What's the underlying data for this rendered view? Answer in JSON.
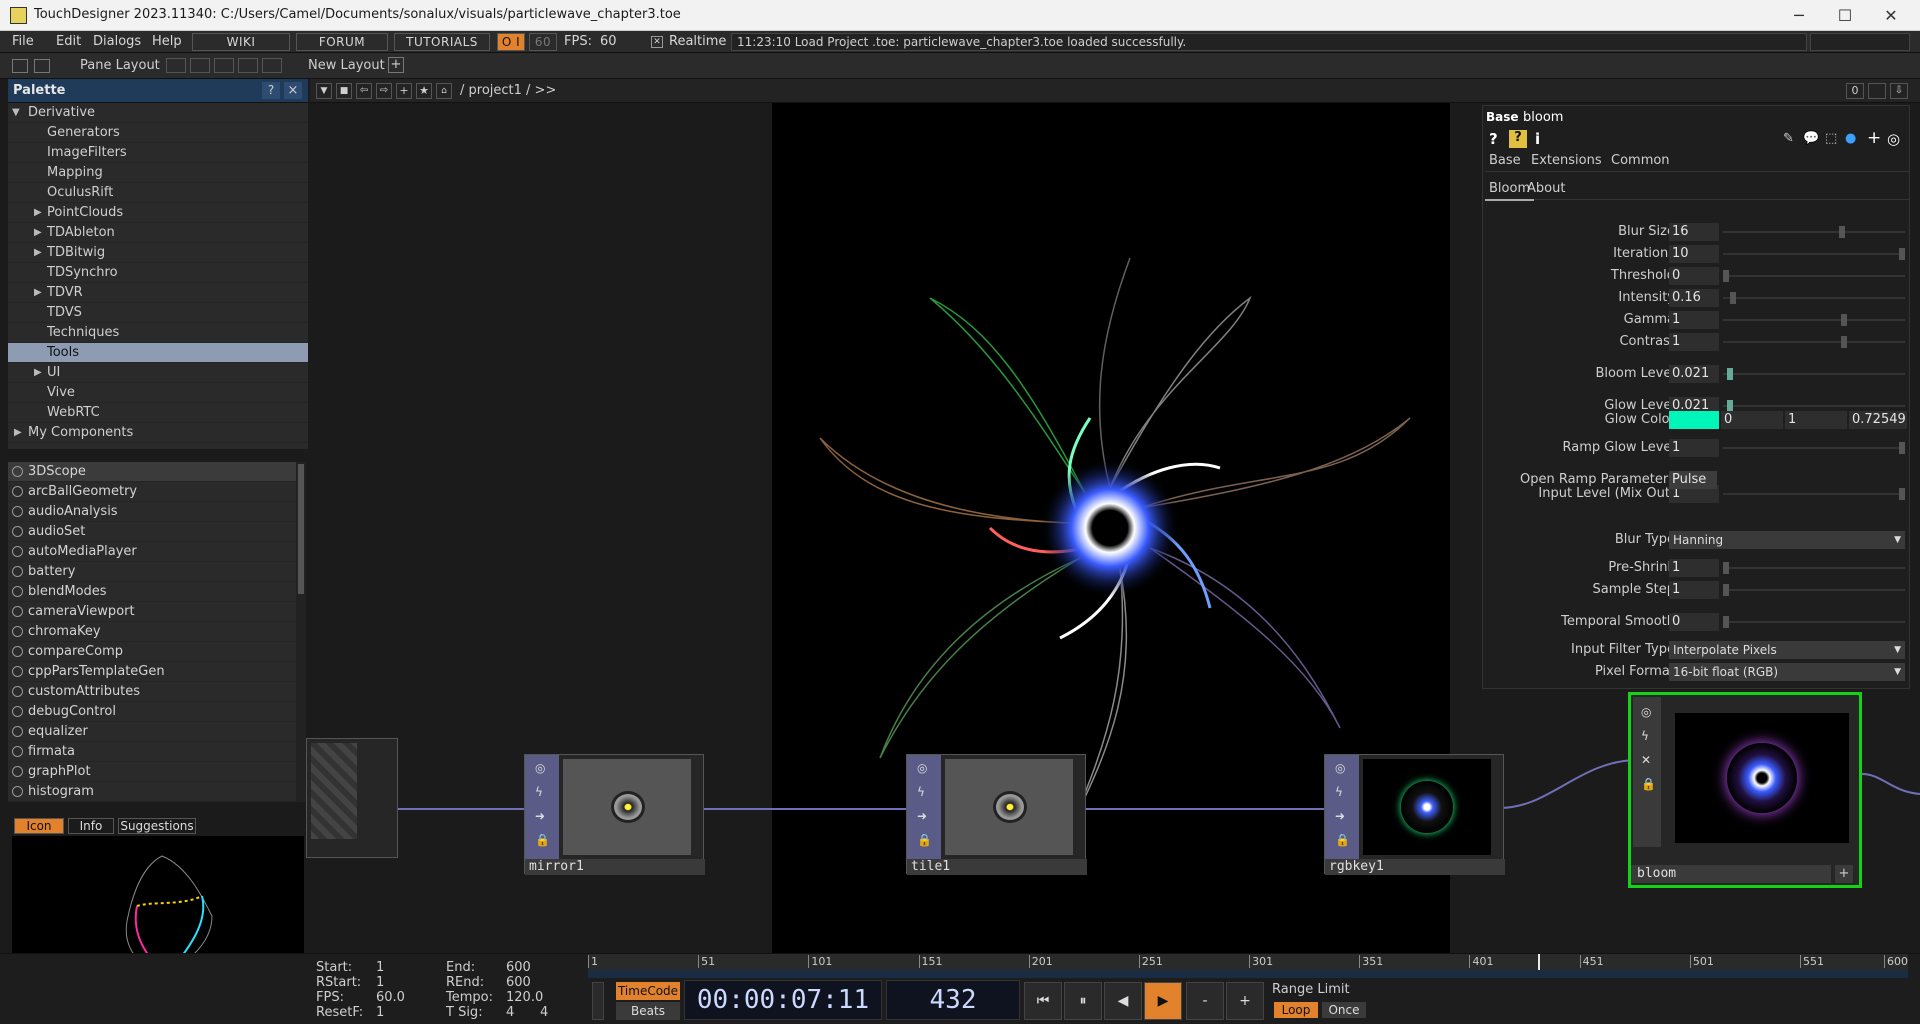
{
  "window": {
    "title": "TouchDesigner 2023.11340: C:/Users/Camel/Documents/sonalux/visuals/particlewave_chapter3.toe"
  },
  "menu": [
    "File",
    "Edit",
    "Dialogs",
    "Help"
  ],
  "nav_buttons": [
    "WIKI",
    "FORUM",
    "TUTORIALS"
  ],
  "perf": {
    "oi": "O I",
    "fps_cap": "60",
    "fps_label": "FPS:",
    "fps_value": "60"
  },
  "realtime_label": "Realtime",
  "status_message": "11:23:10 Load Project .toe: particlewave_chapter3.toe loaded successfully.",
  "toolbar": {
    "pane_layout": "Pane Layout",
    "new_layout": "New Layout"
  },
  "palette": {
    "title": "Palette",
    "help": "?",
    "close": "×",
    "tree": [
      {
        "label": "Derivative",
        "level": 0,
        "expanded": true
      },
      {
        "label": "Generators",
        "level": 1
      },
      {
        "label": "ImageFilters",
        "level": 1
      },
      {
        "label": "Mapping",
        "level": 1
      },
      {
        "label": "OculusRift",
        "level": 1
      },
      {
        "label": "PointClouds",
        "level": 1,
        "collapsed": true
      },
      {
        "label": "TDAbleton",
        "level": 1,
        "collapsed": true
      },
      {
        "label": "TDBitwig",
        "level": 1,
        "collapsed": true
      },
      {
        "label": "TDSynchro",
        "level": 1
      },
      {
        "label": "TDVR",
        "level": 1,
        "collapsed": true
      },
      {
        "label": "TDVS",
        "level": 1
      },
      {
        "label": "Techniques",
        "level": 1
      },
      {
        "label": "Tools",
        "level": 1,
        "selected": true
      },
      {
        "label": "UI",
        "level": 1,
        "collapsed": true
      },
      {
        "label": "Vive",
        "level": 1
      },
      {
        "label": "WebRTC",
        "level": 1
      },
      {
        "label": "My Components",
        "level": 0,
        "collapsed": true
      }
    ],
    "components": [
      "3DScope",
      "arcBallGeometry",
      "audioAnalysis",
      "audioSet",
      "autoMediaPlayer",
      "battery",
      "blendModes",
      "cameraViewport",
      "chromaKey",
      "compareComp",
      "cppParsTemplateGen",
      "customAttributes",
      "debugControl",
      "equalizer",
      "firmata",
      "graphPlot",
      "histogram"
    ],
    "bottom_tabs": [
      "Icon",
      "Info",
      "Suggestions"
    ]
  },
  "network": {
    "path": "/ project1 / >>",
    "zoom_value": "0"
  },
  "nodes": [
    {
      "name": "mirror1"
    },
    {
      "name": "tile1"
    },
    {
      "name": "rgbkey1"
    },
    {
      "name": "bloom"
    }
  ],
  "params": {
    "op_type": "Base",
    "op_name": "bloom",
    "top_tabs": [
      "Base",
      "Extensions",
      "Common"
    ],
    "page_tabs": [
      "Bloom",
      "About"
    ],
    "rows": [
      {
        "label": "Blur Size",
        "value": "16",
        "level": 0.66
      },
      {
        "label": "Iterations",
        "value": "10",
        "level": 1.0
      },
      {
        "label": "Threshold",
        "value": "0",
        "level": 0.0
      },
      {
        "label": "Intensity",
        "value": "0.16",
        "level": 0.04
      },
      {
        "label": "Gamma",
        "value": "1",
        "level": 0.67
      },
      {
        "label": "Contrast",
        "value": "1",
        "level": 0.67
      },
      {
        "label": "Bloom Level",
        "value": "0.021",
        "level": 0.02
      },
      {
        "label": "Glow Level",
        "value": "0.021",
        "level": 0.02
      },
      {
        "label": "Ramp Glow Level",
        "value": "1",
        "level": 1.0
      },
      {
        "label": "Input Level (Mix Out)",
        "value": "1",
        "level": 1.0
      },
      {
        "label": "Pre-Shrink",
        "value": "1",
        "level": 0.0
      },
      {
        "label": "Sample Step",
        "value": "1",
        "level": 0.0
      },
      {
        "label": "Temporal Smooth",
        "value": "0",
        "level": 0.0
      }
    ],
    "glow_color": {
      "label": "Glow Color",
      "r": "0",
      "g": "1",
      "b": "0.72549",
      "swatch": "#00f5b9"
    },
    "open_ramp": {
      "label": "Open Ramp Parameters",
      "button": "Pulse"
    },
    "blur_type": {
      "label": "Blur Type",
      "value": "Hanning"
    },
    "input_filter": {
      "label": "Input Filter Type",
      "value": "Interpolate Pixels"
    },
    "pixel_format": {
      "label": "Pixel Format",
      "value": "16-bit float (RGB)"
    }
  },
  "timeline": {
    "start_label": "Start:",
    "start": "1",
    "end_label": "End:",
    "end": "600",
    "rstart_label": "RStart:",
    "rstart": "1",
    "rend_label": "REnd:",
    "rend": "600",
    "fps_label": "FPS:",
    "fps": "60.0",
    "tempo_label": "Tempo:",
    "tempo": "120.0",
    "resetf_label": "ResetF:",
    "resetf": "1",
    "tsig_label": "T Sig:",
    "tsig_a": "4",
    "tsig_b": "4",
    "ticks": [
      "1",
      "51",
      "101",
      "151",
      "201",
      "251",
      "301",
      "351",
      "401",
      "451",
      "501",
      "551",
      "600"
    ],
    "playhead_frame": 432,
    "timecode_btn": "TimeCode",
    "beats_btn": "Beats",
    "timecode": "00:00:07:11",
    "frame": "432",
    "range_limit": "Range Limit",
    "loop": "Loop",
    "once": "Once"
  }
}
